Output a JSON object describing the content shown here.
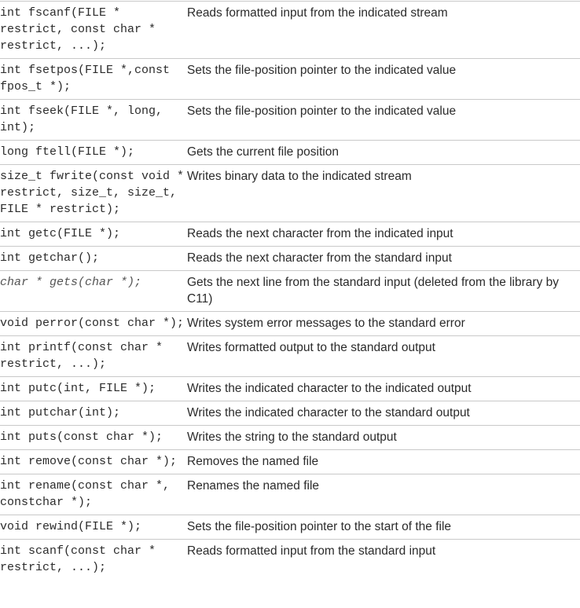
{
  "rows": [
    {
      "prototype": "int fscanf(FILE * restrict, const char * restrict, ...);",
      "description": "Reads formatted input from the indicated stream",
      "italic": false
    },
    {
      "prototype": "int fsetpos(FILE *,const fpos_t *);",
      "description": "Sets the file-position pointer to the indicated value",
      "italic": false
    },
    {
      "prototype": "int fseek(FILE *, long, int);",
      "description": "Sets the file-position pointer to the indicated value",
      "italic": false
    },
    {
      "prototype": "long ftell(FILE *);",
      "description": "Gets the current file position",
      "italic": false
    },
    {
      "prototype": "size_t fwrite(const void * restrict, size_t, size_t, FILE * restrict);",
      "description": "Writes binary data to the indicated stream",
      "italic": false
    },
    {
      "prototype": "int getc(FILE *);",
      "description": "Reads the next character from the indicated input",
      "italic": false
    },
    {
      "prototype": "int getchar();",
      "description": "Reads the next character from the standard input",
      "italic": false
    },
    {
      "prototype": "char * gets(char *);",
      "description": "Gets the next line from the standard input (deleted from the library by C11)",
      "italic": true
    },
    {
      "prototype": "void perror(const char *);",
      "description": "Writes system error messages to the standard error",
      "italic": false
    },
    {
      "prototype": "int printf(const char * restrict, ...);",
      "description": "Writes formatted output to the standard output",
      "italic": false
    },
    {
      "prototype": "int putc(int, FILE *);",
      "description": "Writes the indicated character to the indicated output",
      "italic": false
    },
    {
      "prototype": "int putchar(int);",
      "description": "Writes the indicated character to the standard output",
      "italic": false
    },
    {
      "prototype": "int puts(const char *);",
      "description": "Writes the string to the standard output",
      "italic": false
    },
    {
      "prototype": "int remove(const char *);",
      "description": "Removes the named file",
      "italic": false
    },
    {
      "prototype": "int rename(const char *, constchar *);",
      "description": "Renames the named file",
      "italic": false
    },
    {
      "prototype": "void rewind(FILE *);",
      "description": "Sets the file-position pointer to the start of the file",
      "italic": false
    },
    {
      "prototype": "int scanf(const char * restrict, ...);",
      "description": "Reads formatted input from the standard input",
      "italic": false
    }
  ]
}
